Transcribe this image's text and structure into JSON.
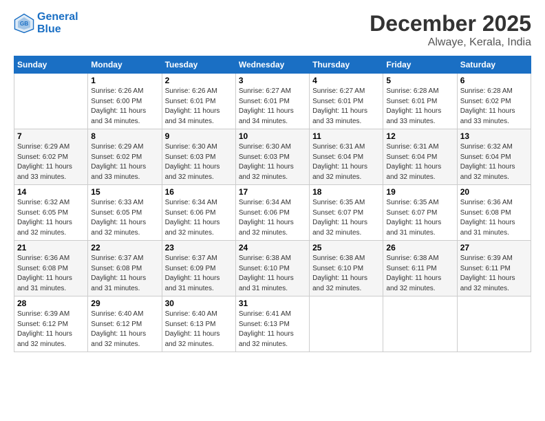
{
  "logo": {
    "line1": "General",
    "line2": "Blue"
  },
  "title": "December 2025",
  "location": "Alwaye, Kerala, India",
  "weekdays": [
    "Sunday",
    "Monday",
    "Tuesday",
    "Wednesday",
    "Thursday",
    "Friday",
    "Saturday"
  ],
  "weeks": [
    [
      {
        "day": "",
        "info": ""
      },
      {
        "day": "1",
        "info": "Sunrise: 6:26 AM\nSunset: 6:00 PM\nDaylight: 11 hours\nand 34 minutes."
      },
      {
        "day": "2",
        "info": "Sunrise: 6:26 AM\nSunset: 6:01 PM\nDaylight: 11 hours\nand 34 minutes."
      },
      {
        "day": "3",
        "info": "Sunrise: 6:27 AM\nSunset: 6:01 PM\nDaylight: 11 hours\nand 34 minutes."
      },
      {
        "day": "4",
        "info": "Sunrise: 6:27 AM\nSunset: 6:01 PM\nDaylight: 11 hours\nand 33 minutes."
      },
      {
        "day": "5",
        "info": "Sunrise: 6:28 AM\nSunset: 6:01 PM\nDaylight: 11 hours\nand 33 minutes."
      },
      {
        "day": "6",
        "info": "Sunrise: 6:28 AM\nSunset: 6:02 PM\nDaylight: 11 hours\nand 33 minutes."
      }
    ],
    [
      {
        "day": "7",
        "info": "Sunrise: 6:29 AM\nSunset: 6:02 PM\nDaylight: 11 hours\nand 33 minutes."
      },
      {
        "day": "8",
        "info": "Sunrise: 6:29 AM\nSunset: 6:02 PM\nDaylight: 11 hours\nand 33 minutes."
      },
      {
        "day": "9",
        "info": "Sunrise: 6:30 AM\nSunset: 6:03 PM\nDaylight: 11 hours\nand 32 minutes."
      },
      {
        "day": "10",
        "info": "Sunrise: 6:30 AM\nSunset: 6:03 PM\nDaylight: 11 hours\nand 32 minutes."
      },
      {
        "day": "11",
        "info": "Sunrise: 6:31 AM\nSunset: 6:04 PM\nDaylight: 11 hours\nand 32 minutes."
      },
      {
        "day": "12",
        "info": "Sunrise: 6:31 AM\nSunset: 6:04 PM\nDaylight: 11 hours\nand 32 minutes."
      },
      {
        "day": "13",
        "info": "Sunrise: 6:32 AM\nSunset: 6:04 PM\nDaylight: 11 hours\nand 32 minutes."
      }
    ],
    [
      {
        "day": "14",
        "info": "Sunrise: 6:32 AM\nSunset: 6:05 PM\nDaylight: 11 hours\nand 32 minutes."
      },
      {
        "day": "15",
        "info": "Sunrise: 6:33 AM\nSunset: 6:05 PM\nDaylight: 11 hours\nand 32 minutes."
      },
      {
        "day": "16",
        "info": "Sunrise: 6:34 AM\nSunset: 6:06 PM\nDaylight: 11 hours\nand 32 minutes."
      },
      {
        "day": "17",
        "info": "Sunrise: 6:34 AM\nSunset: 6:06 PM\nDaylight: 11 hours\nand 32 minutes."
      },
      {
        "day": "18",
        "info": "Sunrise: 6:35 AM\nSunset: 6:07 PM\nDaylight: 11 hours\nand 32 minutes."
      },
      {
        "day": "19",
        "info": "Sunrise: 6:35 AM\nSunset: 6:07 PM\nDaylight: 11 hours\nand 31 minutes."
      },
      {
        "day": "20",
        "info": "Sunrise: 6:36 AM\nSunset: 6:08 PM\nDaylight: 11 hours\nand 31 minutes."
      }
    ],
    [
      {
        "day": "21",
        "info": "Sunrise: 6:36 AM\nSunset: 6:08 PM\nDaylight: 11 hours\nand 31 minutes."
      },
      {
        "day": "22",
        "info": "Sunrise: 6:37 AM\nSunset: 6:08 PM\nDaylight: 11 hours\nand 31 minutes."
      },
      {
        "day": "23",
        "info": "Sunrise: 6:37 AM\nSunset: 6:09 PM\nDaylight: 11 hours\nand 31 minutes."
      },
      {
        "day": "24",
        "info": "Sunrise: 6:38 AM\nSunset: 6:10 PM\nDaylight: 11 hours\nand 31 minutes."
      },
      {
        "day": "25",
        "info": "Sunrise: 6:38 AM\nSunset: 6:10 PM\nDaylight: 11 hours\nand 32 minutes."
      },
      {
        "day": "26",
        "info": "Sunrise: 6:38 AM\nSunset: 6:11 PM\nDaylight: 11 hours\nand 32 minutes."
      },
      {
        "day": "27",
        "info": "Sunrise: 6:39 AM\nSunset: 6:11 PM\nDaylight: 11 hours\nand 32 minutes."
      }
    ],
    [
      {
        "day": "28",
        "info": "Sunrise: 6:39 AM\nSunset: 6:12 PM\nDaylight: 11 hours\nand 32 minutes."
      },
      {
        "day": "29",
        "info": "Sunrise: 6:40 AM\nSunset: 6:12 PM\nDaylight: 11 hours\nand 32 minutes."
      },
      {
        "day": "30",
        "info": "Sunrise: 6:40 AM\nSunset: 6:13 PM\nDaylight: 11 hours\nand 32 minutes."
      },
      {
        "day": "31",
        "info": "Sunrise: 6:41 AM\nSunset: 6:13 PM\nDaylight: 11 hours\nand 32 minutes."
      },
      {
        "day": "",
        "info": ""
      },
      {
        "day": "",
        "info": ""
      },
      {
        "day": "",
        "info": ""
      }
    ]
  ]
}
